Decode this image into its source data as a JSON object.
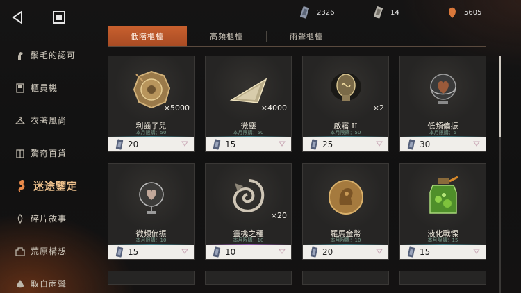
{
  "currencies": [
    {
      "icon": "ticket-stub-icon",
      "value": "2326"
    },
    {
      "icon": "ticket-card-icon",
      "value": "14"
    },
    {
      "icon": "orange-drop-icon",
      "value": "5605"
    }
  ],
  "sidebar": {
    "items": [
      {
        "label": "鬃毛的認可",
        "icon": "horse-icon"
      },
      {
        "label": "櫃員機",
        "icon": "atm-icon"
      },
      {
        "label": "衣著風尚",
        "icon": "hanger-icon"
      },
      {
        "label": "驚奇百貨",
        "icon": "store-icon"
      },
      {
        "label": "迷途鑒定",
        "icon": "seahorse-icon"
      },
      {
        "label": "碎片敘事",
        "icon": "pen-icon"
      },
      {
        "label": "荒原構想",
        "icon": "castle-icon"
      },
      {
        "label": "取自雨聲",
        "icon": "raindrop-icon"
      }
    ],
    "active_index": 4
  },
  "tabs": [
    {
      "label": "低階櫃檯",
      "active": true
    },
    {
      "label": "高頻櫃檯",
      "active": false
    },
    {
      "label": "雨聲櫃檯",
      "active": false
    }
  ],
  "items": [
    {
      "name": "利齒子兒",
      "qty": "×5000",
      "limit": "本月限購：50",
      "price": "20",
      "icon": "gold-coin-icon"
    },
    {
      "name": "微塵",
      "qty": "×4000",
      "limit": "本月限購：50",
      "price": "15",
      "icon": "dust-triangle-icon"
    },
    {
      "name": "啟寤 II",
      "qty": "×2",
      "limit": "本月限購：50",
      "price": "25",
      "icon": "lightbulb-icon"
    },
    {
      "name": "低頻偏振",
      "qty": "",
      "limit": "本月限購：5",
      "price": "30",
      "icon": "globe-heart-icon"
    },
    {
      "name": "微頻偏振",
      "qty": "",
      "limit": "本月限購：10",
      "price": "15",
      "icon": "glass-orb-icon"
    },
    {
      "name": "靈機之種",
      "qty": "×20",
      "limit": "本月限購：10",
      "price": "10",
      "icon": "swirl-seed-icon"
    },
    {
      "name": "羅馬金幣",
      "qty": "",
      "limit": "本月限購：10",
      "price": "20",
      "icon": "roman-coin-icon"
    },
    {
      "name": "液化戰慄",
      "qty": "",
      "limit": "本月限購：15",
      "price": "15",
      "icon": "green-jar-icon"
    }
  ],
  "colors": {
    "accent": "#b8562a",
    "active_side": "#f0c38e",
    "limit_line_blue": "#3f7f8a",
    "limit_line_purple": "#8a55a8"
  }
}
